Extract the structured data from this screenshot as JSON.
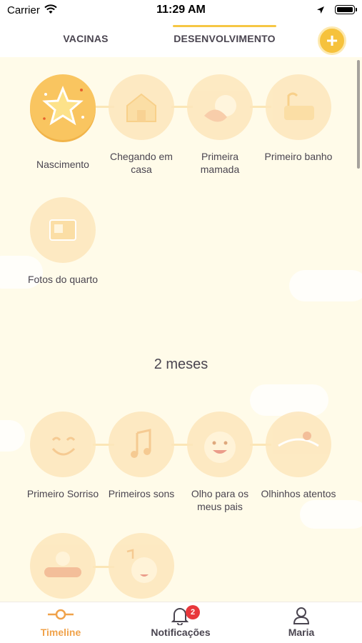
{
  "status_bar": {
    "carrier": "Carrier",
    "time": "11:29 AM"
  },
  "tabs": [
    {
      "label": "VACINAS",
      "active": false
    },
    {
      "label": "DESENVOLVIMENTO",
      "active": true
    }
  ],
  "add_button": {
    "label": "+",
    "icon": "plus-icon"
  },
  "milestones_group_1": [
    {
      "label": "Nascimento",
      "icon": "star-icon",
      "active": true
    },
    {
      "label": "Chegando em casa",
      "icon": "house-icon",
      "active": false
    },
    {
      "label": "Primeira mamada",
      "icon": "bottle-icon",
      "active": false
    },
    {
      "label": "Primeiro banho",
      "icon": "bathtub-icon",
      "active": false
    },
    {
      "label": "Fotos do quarto",
      "icon": "photo-icon",
      "active": false
    }
  ],
  "section_header": "2 meses",
  "milestones_group_2": [
    {
      "label": "Primeiro Sorriso",
      "icon": "smile-icon",
      "active": false
    },
    {
      "label": "Primeiros sons",
      "icon": "music-note-icon",
      "active": false
    },
    {
      "label": "Olho para os meus pais",
      "icon": "baby-face-icon",
      "active": false
    },
    {
      "label": "Olhinhos atentos",
      "icon": "eye-icon",
      "active": false
    },
    {
      "label": "",
      "icon": "baby-lying-icon",
      "active": false
    },
    {
      "label": "",
      "icon": "baby-music-icon",
      "active": false
    }
  ],
  "bottom_nav": [
    {
      "label": "Timeline",
      "icon": "timeline-icon",
      "active": true
    },
    {
      "label": "Notificações",
      "icon": "bell-icon",
      "badge": "2",
      "active": false
    },
    {
      "label": "Maria",
      "icon": "user-icon",
      "active": false
    }
  ],
  "colors": {
    "accent": "#f6c23c",
    "active_label": "#f0a24a",
    "background": "#fffbe9",
    "badge": "#e8373b"
  }
}
